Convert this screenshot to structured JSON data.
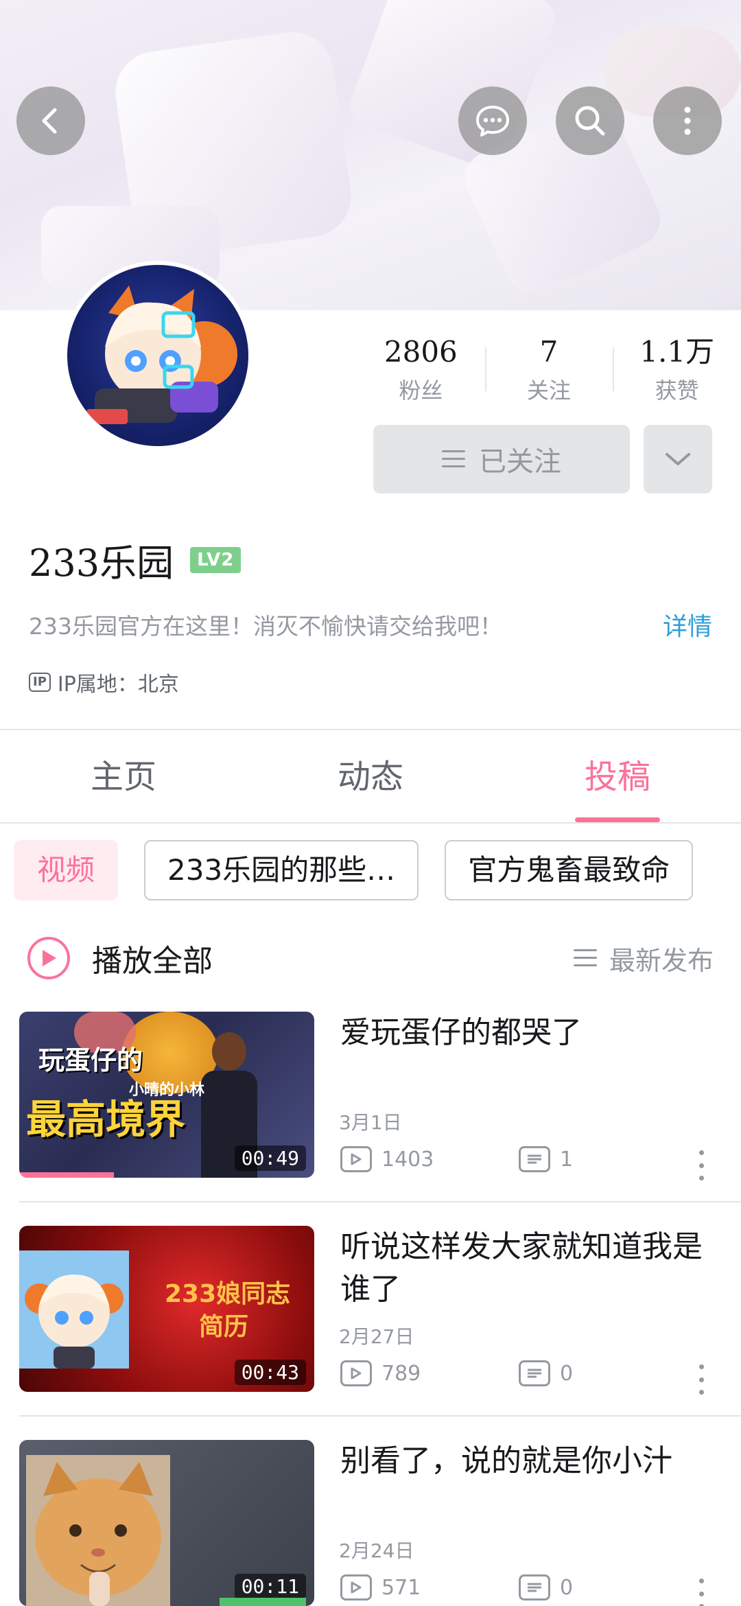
{
  "header": {
    "icons": [
      "back-icon",
      "message-icon",
      "search-icon",
      "more-icon"
    ]
  },
  "profile": {
    "stats": [
      {
        "value": "2806",
        "label": "粉丝"
      },
      {
        "value": "7",
        "label": "关注"
      },
      {
        "value": "1.1万",
        "label": "获赞"
      }
    ],
    "follow_label": "已关注",
    "name": "233乐园",
    "level": "LV2",
    "bio": "233乐园官方在这里！消灭不愉快请交给我吧！",
    "detail_link": "详情",
    "ip_badge": "IP",
    "ip_location": "IP属地：北京"
  },
  "tabs": [
    {
      "label": "主页",
      "active": false
    },
    {
      "label": "动态",
      "active": false
    },
    {
      "label": "投稿",
      "active": true
    }
  ],
  "chips": [
    {
      "label": "视频",
      "active": true
    },
    {
      "label": "233乐园的那些…",
      "active": false
    },
    {
      "label": "官方鬼畜最致命",
      "active": false
    }
  ],
  "play_all": {
    "label": "播放全部",
    "sort_label": "最新发布"
  },
  "videos": [
    {
      "title": "爱玩蛋仔的都哭了",
      "date": "3月1日",
      "views": "1403",
      "comments": "1",
      "duration": "00:49",
      "thumb_caption_1": "玩蛋仔的",
      "thumb_caption_2": "最高境界",
      "thumb_caption_3": "小晴的小林",
      "watched_fraction": 0.32
    },
    {
      "title": "听说这样发大家就知道我是谁了",
      "date": "2月27日",
      "views": "789",
      "comments": "0",
      "duration": "00:43",
      "thumb_caption_1": "233娘同志",
      "thumb_caption_2": "简历"
    },
    {
      "title": "别看了，说的就是你小汁",
      "date": "2月24日",
      "views": "571",
      "comments": "0",
      "duration": "00:11"
    }
  ],
  "colors": {
    "accent": "#fb7299",
    "link": "#2d9fd9",
    "level_badge": "#7fcf8c",
    "muted_text": "#9499a0"
  }
}
